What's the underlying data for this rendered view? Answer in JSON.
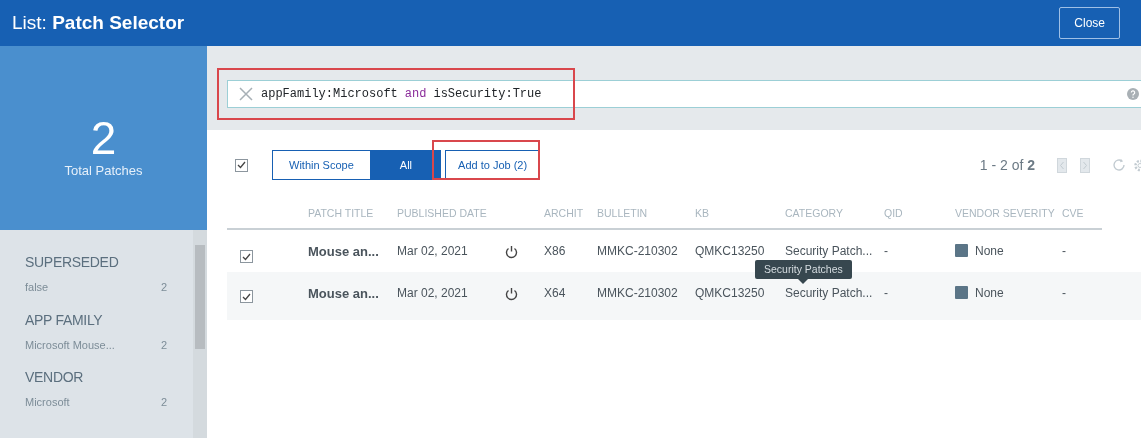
{
  "window": {
    "title_prefix": "List:",
    "title": "Patch Selector",
    "close_button": "Close"
  },
  "summary": {
    "count": "2",
    "label": "Total Patches"
  },
  "filters": [
    {
      "heading": "SUPERSEDED",
      "value": "false",
      "count": "2"
    },
    {
      "heading": "APP FAMILY",
      "value": "Microsoft Mouse...",
      "count": "2"
    },
    {
      "heading": "VENDOR",
      "value": "Microsoft",
      "count": "2"
    }
  ],
  "search": {
    "tokens": [
      {
        "text": "appFamily:Microsoft",
        "kind": "term"
      },
      {
        "text": "and",
        "kind": "operator"
      },
      {
        "text": "isSecurity:True",
        "kind": "term"
      }
    ]
  },
  "toolbar": {
    "select_all_checked": true,
    "scope_options": [
      {
        "label": "Within Scope",
        "selected": false
      },
      {
        "label": "All",
        "selected": true
      }
    ],
    "add_button": "Add to Job (2)",
    "pager": "1 - 2 of **2**"
  },
  "table": {
    "columns": [
      "PATCH TITLE",
      "PUBLISHED DATE",
      "",
      "ARCHIT",
      "BULLETIN",
      "KB",
      "CATEGORY",
      "QID",
      "VENDOR SEVERITY",
      "CVE"
    ],
    "rows": [
      {
        "checked": true,
        "title": "Mouse an...",
        "date": "Mar 02, 2021",
        "arch": "X86",
        "bulletin": "MMKC-210302",
        "kb": "QMKC13250",
        "category": "Security Patch...",
        "qid": "-",
        "severity": "None",
        "cve": "-"
      },
      {
        "checked": true,
        "title": "Mouse an...",
        "date": "Mar 02, 2021",
        "arch": "X64",
        "bulletin": "MMKC-210302",
        "kb": "QMKC13250",
        "category": "Security Patch...",
        "qid": "-",
        "severity": "None",
        "cve": "-"
      }
    ]
  },
  "tooltip": {
    "text": "Security Patches"
  }
}
